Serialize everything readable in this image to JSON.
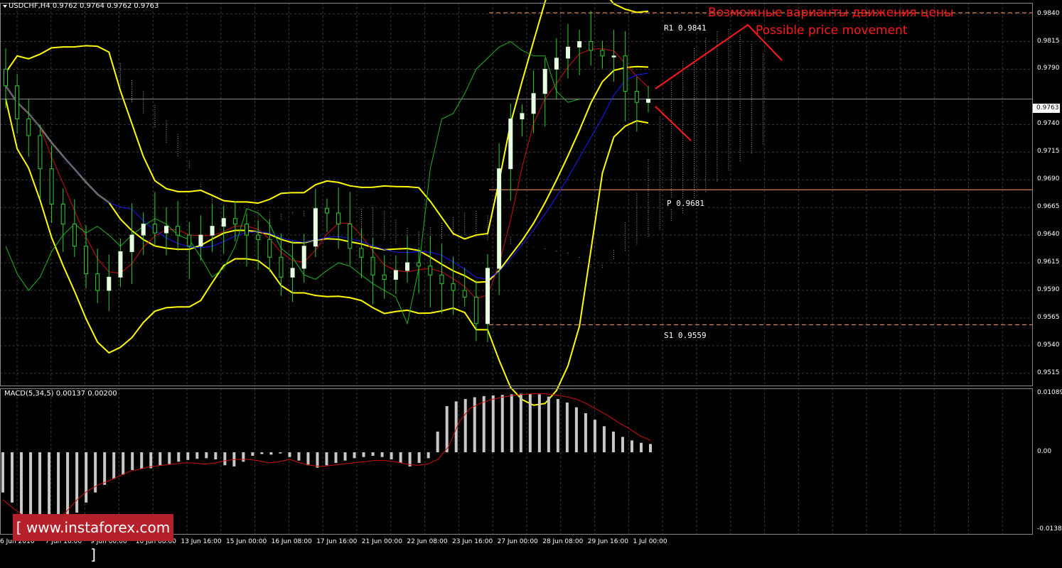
{
  "window": {
    "title": "USDCHF,H4 0.9762 0.9764 0.9762 0.9763",
    "macd_title": "MACD(5,34,5) 0.00137 0.00200",
    "current_price_label": "0.9763",
    "logo_text": "[ www.instaforex.com ]"
  },
  "annotations": {
    "ru": "Возможные варианты движения цены",
    "en": "Possible price movement"
  },
  "levels": {
    "r1": "R1 0.9841",
    "p": "P 0.9681",
    "s1": "S1 0.9559"
  },
  "colors": {
    "background": "#000000",
    "grid": "#3a3a3a",
    "bull_candle": "#e6ffe0",
    "candle_wick": "#2fcf2f",
    "bollinger": "#ffff00",
    "tenkan": "#d01010",
    "kijun": "#1a1aff",
    "chikou": "#1fb81f",
    "ichimoku_cloud_bull": "#d8d8d8",
    "ichimoku_cloud_bear": "#ffa060",
    "macd_hist": "#c8c8c8",
    "macd_signal": "#d01010",
    "pivot_line": "#ffa060",
    "arrow": "#ff1a1a"
  },
  "chart_data": [
    {
      "type": "candlestick",
      "title": "USDCHF,H4",
      "ylim": [
        0.9504,
        0.985
      ],
      "y_ticks": [
        "0.9840",
        "0.9815",
        "0.9790",
        "0.9763",
        "0.9740",
        "0.9715",
        "0.9690",
        "0.9665",
        "0.9640",
        "0.9615",
        "0.9590",
        "0.9565",
        "0.9540",
        "0.9515"
      ],
      "x_ticks": [
        "6 Jun 2016",
        "7 Jun 16:00",
        "9 Jun 00:00",
        "10 Jun 08:00",
        "13 Jun 16:00",
        "15 Jun 00:00",
        "16 Jun 08:00",
        "17 Jun 16:00",
        "21 Jun 00:00",
        "22 Jun 08:00",
        "23 Jun 16:00",
        "27 Jun 00:00",
        "28 Jun 08:00",
        "29 Jun 16:00",
        "1 Jul 00:00"
      ],
      "close": [
        0.9775,
        0.9745,
        0.973,
        0.97,
        0.9668,
        0.965,
        0.963,
        0.9605,
        0.959,
        0.9602,
        0.9625,
        0.964,
        0.965,
        0.9642,
        0.9648,
        0.964,
        0.963,
        0.964,
        0.9648,
        0.9655,
        0.965,
        0.964,
        0.9636,
        0.962,
        0.9602,
        0.961,
        0.963,
        0.9664,
        0.966,
        0.965,
        0.9628,
        0.962,
        0.9604,
        0.96,
        0.9608,
        0.9615,
        0.9612,
        0.9604,
        0.9596,
        0.959,
        0.9584,
        0.956,
        0.961,
        0.97,
        0.9745,
        0.975,
        0.9768,
        0.979,
        0.98,
        0.981,
        0.9815,
        0.9807,
        0.9802,
        0.9802,
        0.977,
        0.976,
        0.9763
      ],
      "series": [
        {
          "name": "Pivot",
          "values": [
            0.9681
          ]
        },
        {
          "name": "R1",
          "values": [
            0.9841
          ]
        },
        {
          "name": "S1",
          "values": [
            0.9559
          ]
        }
      ],
      "annotations": [
        "Возможные варианты движения цены",
        "Possible price movement",
        "R1 0.9841",
        "P 0.9681",
        "S1 0.9559"
      ]
    },
    {
      "type": "bar",
      "title": "MACD(5,34,5) 0.00137 0.00200",
      "ylim": [
        -0.0138,
        0.0108
      ],
      "y_ticks": [
        "0.01089",
        "0.00",
        "-0.0138"
      ],
      "values": [
        -0.0068,
        -0.0085,
        -0.0105,
        -0.0118,
        -0.0128,
        -0.0134,
        -0.0132,
        -0.012,
        -0.0102,
        -0.0085,
        -0.0068,
        -0.0055,
        -0.0045,
        -0.0038,
        -0.003,
        -0.0028,
        -0.0027,
        -0.0022,
        -0.002,
        -0.0016,
        -0.0013,
        -0.0011,
        -0.001,
        -0.0012,
        -0.0022,
        -0.0024,
        -0.0016,
        -0.0006,
        -0.0003,
        -0.0004,
        -0.0002,
        -0.0008,
        -0.0014,
        -0.0022,
        -0.0026,
        -0.0022,
        -0.0018,
        -0.0014,
        -0.001,
        -0.0008,
        -0.0006,
        -0.0008,
        -0.0012,
        -0.0018,
        -0.0024,
        -0.0018,
        -0.001,
        0.0035,
        0.0078,
        0.0086,
        0.009,
        0.0093,
        0.0095,
        0.0096,
        0.0097,
        0.0098,
        0.0099,
        0.0099,
        0.0098,
        0.0094,
        0.009,
        0.0084,
        0.0076,
        0.0066,
        0.0055,
        0.0044,
        0.0035,
        0.0026,
        0.002,
        0.0016,
        0.0014
      ],
      "signal": [
        -0.008,
        -0.0095,
        -0.0108,
        -0.012,
        -0.0126,
        -0.0118,
        -0.01,
        -0.008,
        -0.0065,
        -0.0055,
        -0.0048,
        -0.004,
        -0.0032,
        -0.0028,
        -0.0024,
        -0.0022,
        -0.002,
        -0.0018,
        -0.0018,
        -0.002,
        -0.0018,
        -0.0014,
        -0.0012,
        -0.0012,
        -0.0014,
        -0.0018,
        -0.0016,
        -0.0012,
        -0.0018,
        -0.0022,
        -0.0024,
        -0.0022,
        -0.002,
        -0.0018,
        -0.0016,
        -0.0014,
        -0.0014,
        -0.0016,
        -0.002,
        -0.0022,
        -0.002,
        -0.0012,
        0.001,
        0.0052,
        0.0074,
        0.0083,
        0.0089,
        0.0093,
        0.0096,
        0.0098,
        0.0099,
        0.0099,
        0.0097,
        0.0094,
        0.009,
        0.0082,
        0.0072,
        0.0062,
        0.005,
        0.004,
        0.0028,
        0.002
      ]
    }
  ]
}
